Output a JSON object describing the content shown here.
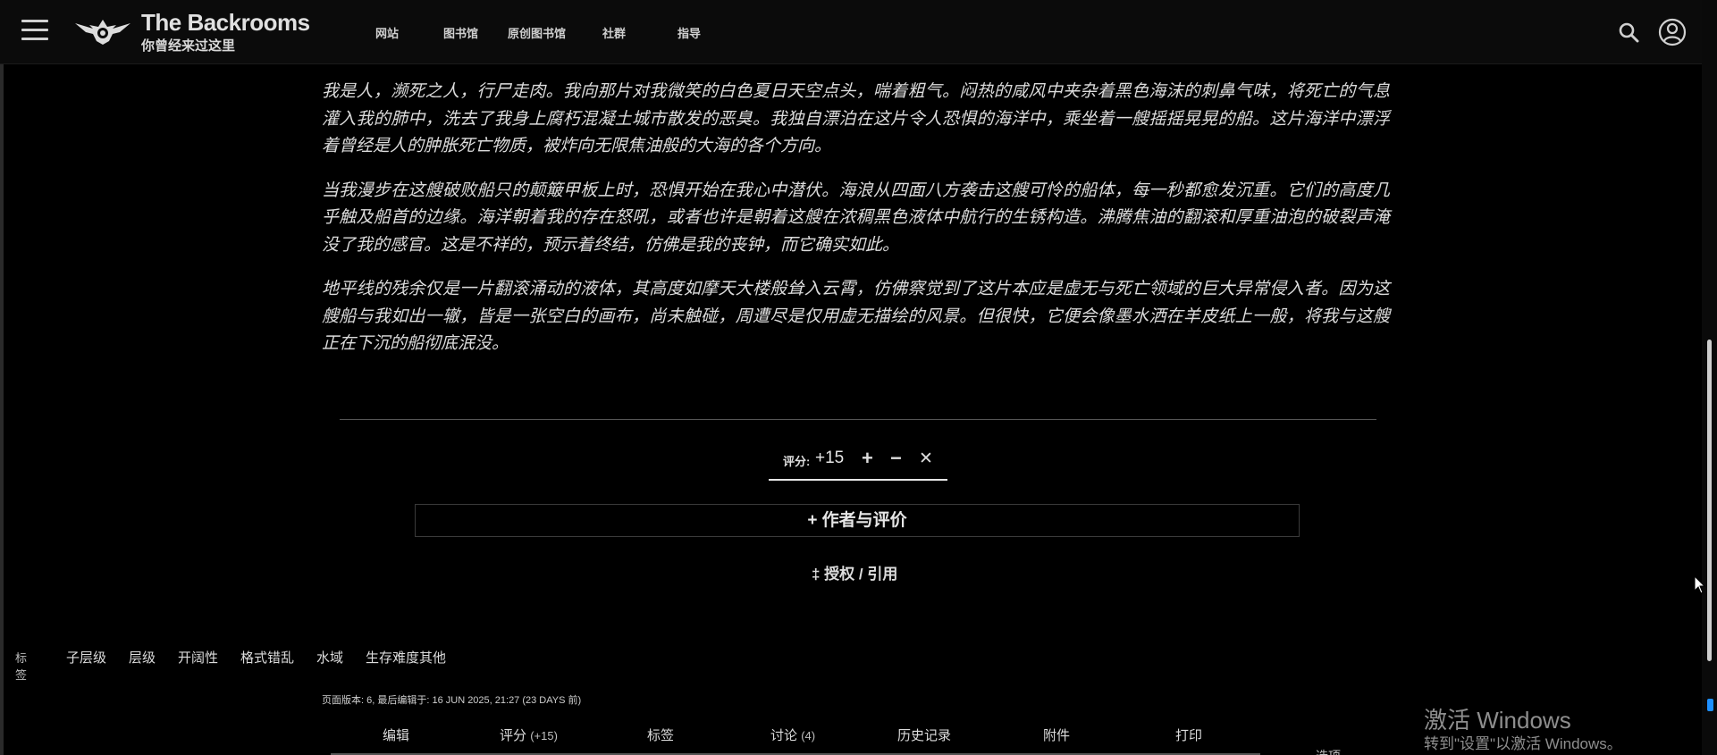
{
  "header": {
    "site_title": "The Backrooms",
    "site_subtitle": "你曾经来过这里",
    "nav": [
      "网站",
      "图书馆",
      "原创图书馆",
      "社群",
      "指导"
    ]
  },
  "article": {
    "paragraphs": [
      "我是人，濒死之人，行尸走肉。我向那片对我微笑的白色夏日天空点头，喘着粗气。闷热的咸风中夹杂着黑色海沫的刺鼻气味，将死亡的气息灌入我的肺中，洗去了我身上腐朽混凝土城市散发的恶臭。我独自漂泊在这片令人恐惧的海洋中，乘坐着一艘摇摇晃晃的船。这片海洋中漂浮着曾经是人的肿胀死亡物质，被炸向无限焦油般的大海的各个方向。",
      "当我漫步在这艘破败船只的颠簸甲板上时，恐惧开始在我心中潜伏。海浪从四面八方袭击这艘可怜的船体，每一秒都愈发沉重。它们的高度几乎触及船首的边缘。海洋朝着我的存在怒吼，或者也许是朝着这艘在浓稠黑色液体中航行的生锈构造。沸腾焦油的翻滚和厚重油泡的破裂声淹没了我的感官。这是不祥的，预示着终结，仿佛是我的丧钟，而它确实如此。",
      "地平线的残余仅是一片翻滚涌动的液体，其高度如摩天大楼般耸入云霄，仿佛察觉到了这片本应是虚无与死亡领域的巨大异常侵入者。因为这艘船与我如出一辙，皆是一张空白的画布，尚未触碰，周遭尽是仅用虚无描绘的风景。但很快，它便会像墨水洒在羊皮纸上一般，将我与这艘正在下沉的船彻底泯没。"
    ]
  },
  "rating": {
    "label": "评分:",
    "score": "+15",
    "plus": "+",
    "minus": "−",
    "cancel": "✕"
  },
  "author_box": "+ 作者与评价",
  "license": "‡ 授权 / 引用",
  "tags": {
    "label": "标签",
    "items": [
      "子层级",
      "层级",
      "开阔性",
      "格式错乱",
      "水域",
      "生存难度其他"
    ]
  },
  "page_info": "页面版本: 6, 最后编辑于: 16 JUN 2025, 21:27 (23 DAYS 前)",
  "page_options": {
    "edit": "编辑",
    "rate": "评分",
    "rate_count": "(+15)",
    "tags": "标签",
    "discuss": "讨论",
    "discuss_count": "(4)",
    "history": "历史记录",
    "files": "附件",
    "print": "打印",
    "options": "选项"
  },
  "watermark": {
    "title": "激活 Windows",
    "subtitle": "转到\"设置\"以激活 Windows。"
  }
}
